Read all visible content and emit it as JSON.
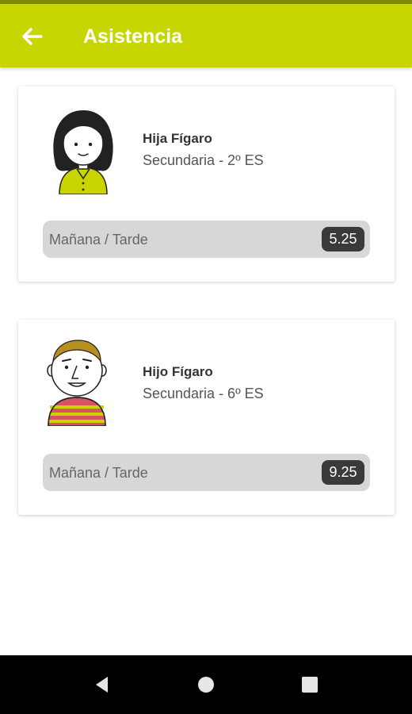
{
  "header": {
    "title": "Asistencia",
    "back_icon": "arrow-left-icon",
    "color": "#c7d600"
  },
  "students": [
    {
      "name": "Hija Fígaro",
      "level": "Secundaria - 2º ES",
      "attendance_label": "Mañana / Tarde",
      "attendance_value": "5.25",
      "avatar": "girl-avatar-icon"
    },
    {
      "name": "Hijo Fígaro",
      "level": "Secundaria - 6º ES",
      "attendance_label": "Mañana / Tarde",
      "attendance_value": "9.25",
      "avatar": "boy-avatar-icon"
    }
  ],
  "navbar": {
    "icons": [
      "back-triangle-icon",
      "home-circle-icon",
      "recents-square-icon"
    ]
  }
}
